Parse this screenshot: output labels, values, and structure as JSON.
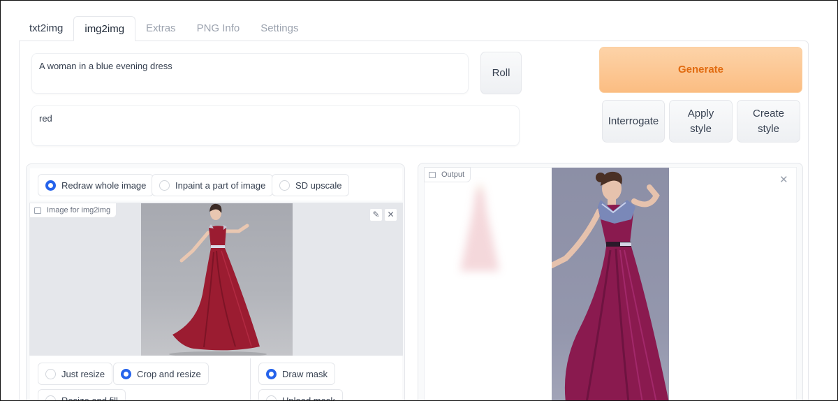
{
  "tabs": [
    "txt2img",
    "img2img",
    "Extras",
    "PNG Info",
    "Settings"
  ],
  "prompt": {
    "positive": "A woman in a blue evening dress",
    "negative": "red"
  },
  "buttons": {
    "roll": "Roll",
    "generate": "Generate",
    "interrogate": "Interrogate",
    "apply_style": "Apply style",
    "create_style": "Create style"
  },
  "mode_options": [
    {
      "label": "Redraw whole image",
      "selected": true
    },
    {
      "label": "Inpaint a part of image",
      "selected": false
    },
    {
      "label": "SD upscale",
      "selected": false
    }
  ],
  "input_image": {
    "label": "Image for img2img",
    "icon": "image-icon",
    "edit_icon": "pencil-icon",
    "clear_icon": "close-icon"
  },
  "resize_options": [
    {
      "label": "Just resize",
      "selected": false
    },
    {
      "label": "Crop and resize",
      "selected": true
    },
    {
      "label": "Resize and fill",
      "selected": false
    }
  ],
  "mask_options": [
    {
      "label": "Draw mask",
      "selected": true
    },
    {
      "label": "Upload mask",
      "selected": false
    }
  ],
  "output": {
    "label": "Output",
    "icon": "image-icon",
    "close_icon": "close-icon"
  },
  "colors": {
    "accent": "#2563eb",
    "generate_bg": "#fbbd82",
    "generate_text": "#e16b10",
    "dress_input": "#9b1c31",
    "dress_output": "#8a1a4f"
  }
}
